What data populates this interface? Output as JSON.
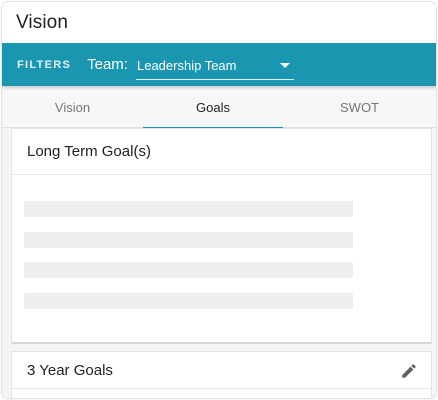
{
  "header": {
    "title": "Vision"
  },
  "filters": {
    "label": "FILTERS",
    "team_label": "Team:",
    "team_value": "Leadership Team"
  },
  "tabs": [
    {
      "label": "Vision",
      "active": false
    },
    {
      "label": "Goals",
      "active": true
    },
    {
      "label": "SWOT",
      "active": false
    }
  ],
  "long_term": {
    "title": "Long Term Goal(s)",
    "loading_rows": 4
  },
  "three_year": {
    "title": "3 Year Goals",
    "action_icon": "pencil-edit-icon"
  },
  "colors": {
    "accent": "#1a96b0",
    "filters_bar": "#1a96b0",
    "tab_bar": "#f7f7f7",
    "skeleton": "#eeeeee"
  }
}
